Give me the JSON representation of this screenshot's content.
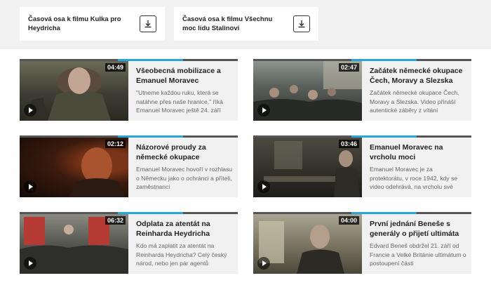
{
  "downloads": [
    {
      "label": "Časová osa k filmu Kulka pro Heydricha"
    },
    {
      "label": "Časová osa k filmu Všechnu moc lidu Stalinovi"
    }
  ],
  "videos": [
    {
      "duration": "04:49",
      "title": "Všeobecná mobilizace a Emanuel Moravec",
      "description": "\"Utneme každou ruku, která se natáhne přes naše hranice,\" říká Emanuel Moravec ještě 24. září"
    },
    {
      "duration": "02:47",
      "title": "Začátek německé okupace Čech, Moravy a Slezska",
      "description": "Začátek německé okupace Čech, Moravy a Slezska. Video přináší autentické záběry z vítání"
    },
    {
      "duration": "02:12",
      "title": "Názorové proudy za německé okupace",
      "description": "Emanuel Moravec hovoří v rozhlasu o Německu jako o ochránci a příteli, zaměstnanci"
    },
    {
      "duration": "03:46",
      "title": "Emanuel Moravec na vrcholu moci",
      "description": "Emanuel Moravec je za protektorátu, v roce 1942, kdy se video odehrává, na vrcholu své"
    },
    {
      "duration": "06:32",
      "title": "Odplata za atentát na Reinharda Heydricha",
      "description": "Kdo má zaplatit za atentát na Reinharda Heydricha? Celý český národ, nebo jen pár agentů"
    },
    {
      "duration": "04:00",
      "title": "První jednání Beneše s generály o přijetí ultimáta",
      "description": "Edvard Beneš obdržel 21. září od Francie a Velké Británie ultimátum o postoupení části"
    }
  ],
  "colors": {
    "accent": "#27a7d8",
    "card_bg": "#f1f1f1",
    "bar": "#555555"
  }
}
